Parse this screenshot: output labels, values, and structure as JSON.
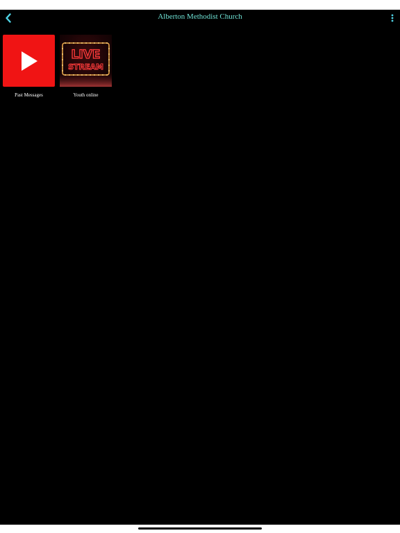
{
  "header": {
    "title": "Alberton Methodist Church",
    "back_icon": "chevron-left-icon",
    "menu_icon": "more-vertical-icon"
  },
  "tiles": [
    {
      "label": "Past Messages",
      "icon": "youtube-play-icon"
    },
    {
      "label": "Youth online",
      "icon": "live-stream-sign",
      "sign_line1": "LIVE",
      "sign_line2": "STREAM"
    }
  ],
  "colors": {
    "background": "#000000",
    "accent": "#6fe3d6",
    "youtube_red": "#f01414",
    "label": "#ffffff"
  }
}
